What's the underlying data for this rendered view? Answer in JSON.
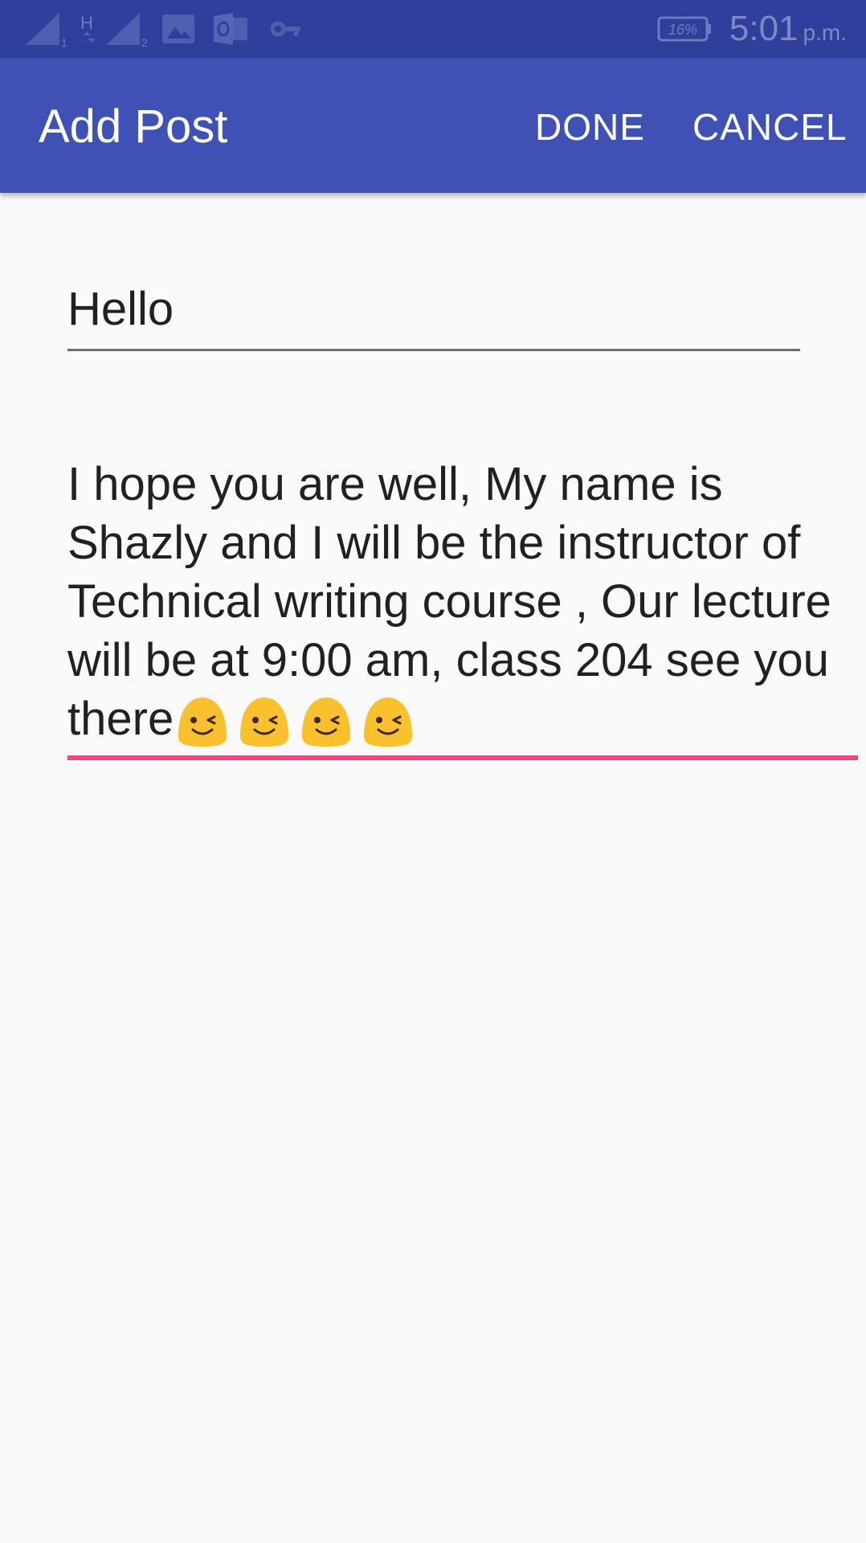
{
  "status_bar": {
    "time": "5:01",
    "ampm": "p.m.",
    "battery": "16%",
    "network_label": "H",
    "sim1": "1",
    "sim2": "2",
    "icons": [
      "signal-sim1-icon",
      "h-network-icon",
      "signal-sim2-icon",
      "gallery-icon",
      "outlook-icon",
      "vpn-key-icon",
      "battery-icon"
    ]
  },
  "app_bar": {
    "title": "Add Post",
    "done_label": "DONE",
    "cancel_label": "CANCEL",
    "color": "#3f51b5"
  },
  "form": {
    "title_value": "Hello",
    "body_value": "I hope you are well, My name is Shazly and I will be the instructor of Technical writing course , Our lecture will be at 9:00 am, class 204 see you there",
    "body_emoji": [
      "winking-face-emoji",
      "winking-face-emoji",
      "winking-face-emoji",
      "winking-face-emoji"
    ],
    "focus_underline_color": "#e94a7e"
  }
}
